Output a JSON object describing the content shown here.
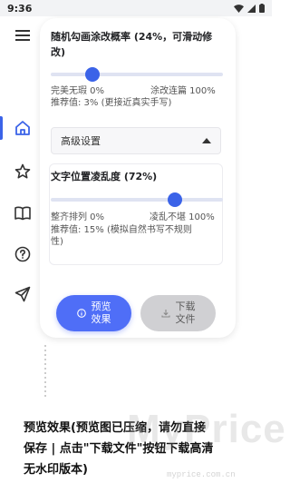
{
  "status_bar": {
    "time": "9:36",
    "colors": {
      "icon": "#333333"
    }
  },
  "nav": {
    "menu_icon": "hamburger-menu-icon",
    "items": [
      {
        "icon": "home-icon",
        "active": true
      },
      {
        "icon": "star-icon",
        "active": false
      },
      {
        "icon": "book-icon",
        "active": false
      },
      {
        "icon": "help-circle-icon",
        "active": false
      },
      {
        "icon": "send-icon",
        "active": false
      }
    ],
    "accent": "#3b63e8"
  },
  "settings": {
    "random_stroke": {
      "title_line1": "随机勾画涂改概率 (24%，可滑动修",
      "title_line2": "改)",
      "value_percent": 24,
      "min_label": "完美无瑕 0%",
      "max_label": "涂改连篇 100%",
      "recommend": "推荐值: 3% (更接近真实手写)"
    },
    "advanced": {
      "label": "高级设置",
      "expanded": true
    },
    "text_offset": {
      "title": "文字位置凌乱度 (72%)",
      "value_percent": 72,
      "min_label": "整齐排列 0%",
      "max_label": "凌乱不堪 100%",
      "recommend_line1": "推荐值: 15% (模拟自然书写不规则",
      "recommend_line2": "性)"
    }
  },
  "actions": {
    "preview": {
      "line1": "预览",
      "line2": "效果",
      "icon": "info-icon"
    },
    "download": {
      "line1": "下载",
      "line2": "文件",
      "icon": "download-icon"
    }
  },
  "footer": {
    "text_line1": "预览效果(预览图已压缩，请勿直接",
    "text_line2": "保存 | 点击\"下载文件\"按钮下载高清",
    "text_line3": "无水印版本)"
  },
  "watermark": {
    "brand": "MyPrice",
    "url": "myprice.com.cn"
  }
}
